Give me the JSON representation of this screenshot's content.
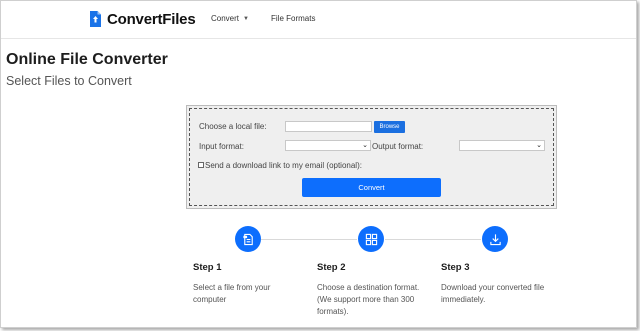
{
  "header": {
    "brand": "ConvertFiles",
    "nav": {
      "convert": "Convert",
      "file_formats": "File Formats"
    }
  },
  "page": {
    "title": "Online File Converter",
    "subtitle": "Select Files to Convert"
  },
  "converter": {
    "local_file_label": "Choose a local file:",
    "browse_label": "Browse",
    "input_format_label": "Input format:",
    "output_format_label": "Output format:",
    "email_label": "Send a download link to my email (optional):",
    "convert_label": "Convert",
    "input_format_value": "",
    "output_format_value": ""
  },
  "steps": [
    {
      "title": "Step 1",
      "desc": "Select a file from your computer",
      "icon": "file-icon"
    },
    {
      "title": "Step 2",
      "desc": "Choose a destination format. (We support more than 300 formats).",
      "icon": "grid-icon"
    },
    {
      "title": "Step 3",
      "desc": "Download your converted file immediately.",
      "icon": "download-icon"
    }
  ],
  "colors": {
    "accent": "#0d6efd",
    "browse": "#1b6fe0"
  }
}
